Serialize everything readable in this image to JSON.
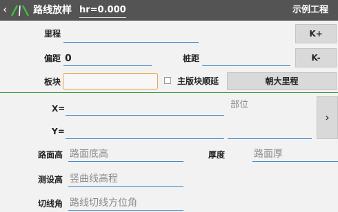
{
  "header": {
    "back_glyph": "‹",
    "title": "路线放样",
    "hr": "hr=0.000",
    "project": "示例工程"
  },
  "form": {
    "mileage_label": "里程",
    "mileage_value": "",
    "kplus": "K+",
    "offset_label": "偏距",
    "offset_value": "0",
    "stake_label": "桩距",
    "stake_value": "",
    "kminus": "K-",
    "slab_label": "板块",
    "slab_value": "",
    "main_slab_label": "主版块顺延",
    "toward_button": "朝大里程",
    "x_label": "X=",
    "y_label": "Y=",
    "part_placeholder": "部位",
    "arrow_glyph": "›",
    "road_elev_label": "路面高",
    "road_elev_placeholder": "路面底高",
    "thickness_label": "厚度",
    "thickness_placeholder": "路面厚",
    "survey_elev_label": "测设高",
    "survey_elev_placeholder": "竖曲线高程",
    "tangent_label": "切线角",
    "tangent_placeholder": "路线切线方位角"
  },
  "colors": {
    "accent": "#3d86c6",
    "separator": "#35a035",
    "topbar": "#545454",
    "focus": "#e6a23c"
  }
}
